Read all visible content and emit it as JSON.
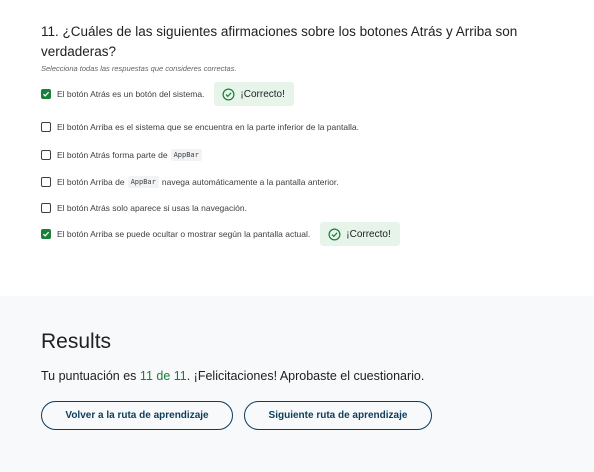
{
  "question": {
    "title": "11. ¿Cuáles de las siguientes afirmaciones sobre los botones Atrás y Arriba son verdaderas?",
    "hint": "Selecciona todas las respuestas que consideres correctas.",
    "options": [
      {
        "text": "El botón Atrás es un botón del sistema.",
        "checked": true,
        "feedback": "¡Correcto!"
      },
      {
        "text": "El botón Arriba es el sistema que se encuentra en la parte inferior de la pantalla.",
        "checked": false
      },
      {
        "pre": "El botón Atrás forma parte de",
        "code": "AppBar",
        "post": "",
        "checked": false
      },
      {
        "pre": "El botón Arriba de",
        "code": "AppBar",
        "post": "navega automáticamente a la pantalla anterior.",
        "checked": false
      },
      {
        "text": "El botón Atrás solo aparece si usas la navegación.",
        "checked": false
      },
      {
        "text": "El botón Arriba se puede ocultar o mostrar según la pantalla actual.",
        "checked": true,
        "feedback": "¡Correcto!"
      }
    ]
  },
  "results": {
    "title": "Results",
    "score_prefix": "Tu puntuación es",
    "score_value": "11 de 11",
    "score_suffix": ". ¡Felicitaciones! Aprobaste el cuestionario.",
    "back_button": "Volver a la ruta de aprendizaje",
    "next_button": "Siguiente ruta de aprendizaje"
  },
  "colors": {
    "correct": "#188038",
    "correct_bg": "#e6f4ea",
    "button_text": "#0d3d5c"
  },
  "icons": {
    "checkbox_checked": "checkmark-icon",
    "feedback": "check-circle-icon"
  }
}
